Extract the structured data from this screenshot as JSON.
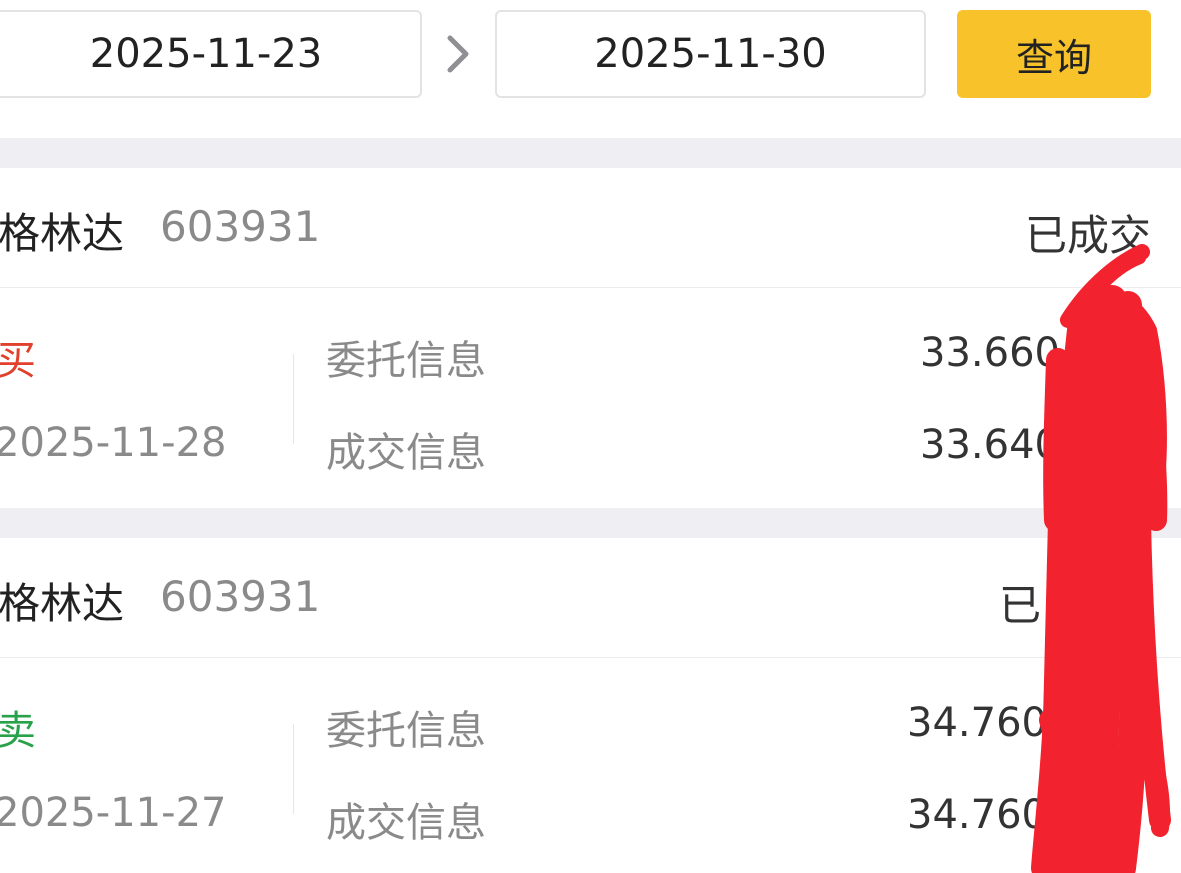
{
  "filter": {
    "start_date": "2025-11-23",
    "end_date": "2025-11-30",
    "query_label": "查询",
    "separator_icon": "chevron-right-icon"
  },
  "orders": [
    {
      "stock_name": "格林达",
      "stock_code": "603931",
      "status": "已成交",
      "side": "买",
      "side_color": "#e0402c",
      "date": "2025-11-28",
      "entrust_label": "委托信息",
      "deal_label": "成交信息",
      "entrust_price": "33.660",
      "deal_price": "33.640"
    },
    {
      "stock_name": "格林达",
      "stock_code": "603931",
      "status": "已",
      "side": "卖",
      "side_color": "#27a24a",
      "date": "2025-11-27",
      "entrust_label": "委托信息",
      "deal_label": "成交信息",
      "entrust_price": "34.760",
      "deal_price": "34.760"
    }
  ],
  "colors": {
    "accent": "#f8c22b",
    "buy": "#e0402c",
    "sell": "#27a24a",
    "scribble": "#f2222e"
  }
}
